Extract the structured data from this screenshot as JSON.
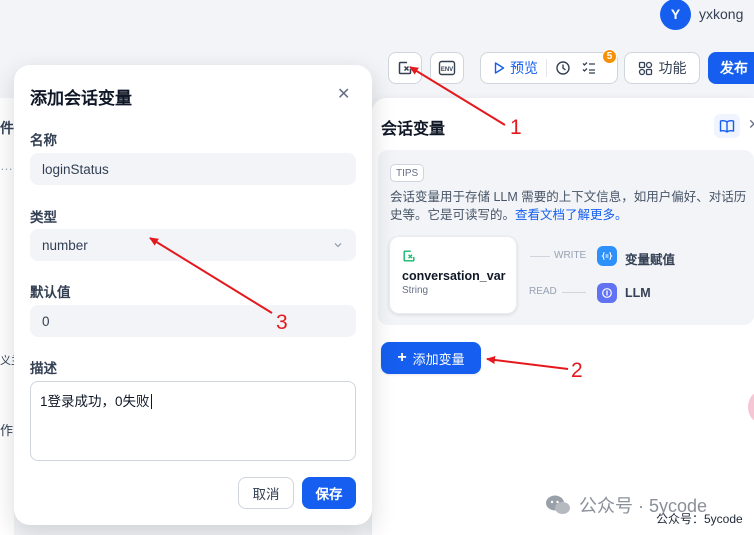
{
  "user": {
    "avatar_initial": "Y",
    "name": "yxkong"
  },
  "toolbar": {
    "preview_label": "预览",
    "features_label": "功能",
    "publish_label": "发布",
    "badge_count": "5",
    "env_label": "ENV"
  },
  "left_strip": {
    "texts": [
      "件",
      "…",
      "义兰",
      "作"
    ]
  },
  "panel": {
    "title": "会话变量",
    "tips_tag": "TIPS",
    "tips_text": "会话变量用于存储 LLM 需要的上下文信息，如用户偏好、对话历史等。它是可读写的。",
    "tips_link": "查看文档了解更多。",
    "var_name": "conversation_var",
    "var_type": "String",
    "write_label": "WRITE",
    "read_label": "READ",
    "write_node": "变量赋值",
    "read_node": "LLM",
    "add_button": "添加变量"
  },
  "dialog": {
    "title": "添加会话变量",
    "name_label": "名称",
    "name_value": "loginStatus",
    "type_label": "类型",
    "type_value": "number",
    "default_label": "默认值",
    "default_value": "0",
    "desc_label": "描述",
    "desc_value": "1登录成功，0失败",
    "cancel_label": "取消",
    "save_label": "保存"
  },
  "annotations": {
    "n1": "1",
    "n2": "2",
    "n3": "3"
  },
  "watermark": {
    "big": "公众号 · 5ycode",
    "small": "公众号：5ycode"
  },
  "colors": {
    "accent": "#155eef",
    "arrow": "#e5191d",
    "badge": "#f79009"
  }
}
